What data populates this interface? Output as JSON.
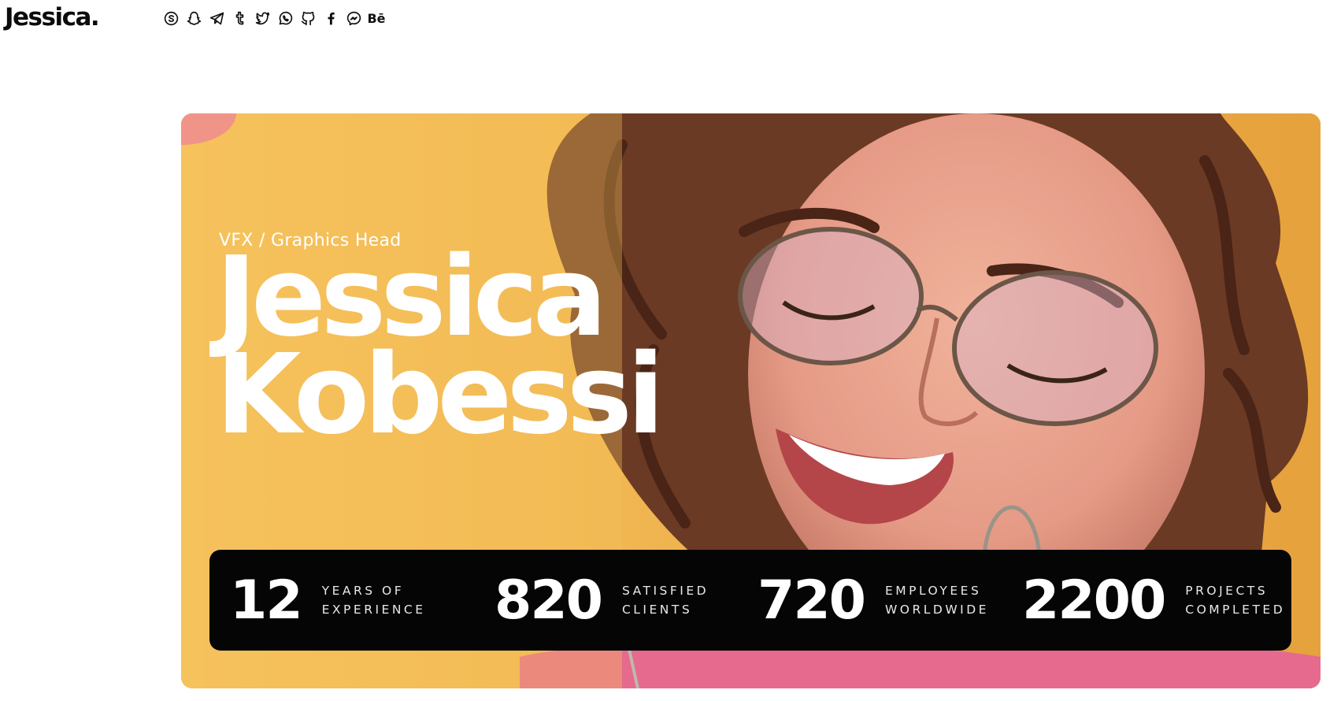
{
  "header": {
    "logo": "Jessica.",
    "social_icons": [
      {
        "name": "skype-icon"
      },
      {
        "name": "snapchat-icon"
      },
      {
        "name": "telegram-icon"
      },
      {
        "name": "tumblr-icon"
      },
      {
        "name": "twitter-icon"
      },
      {
        "name": "whatsapp-icon"
      },
      {
        "name": "github-icon"
      },
      {
        "name": "facebook-icon"
      },
      {
        "name": "messenger-icon"
      },
      {
        "name": "behance-icon",
        "text": "Bē"
      }
    ]
  },
  "hero": {
    "role": "VFX / Graphics Head",
    "first_name": "Jessica",
    "last_name": "Kobessi",
    "stats": [
      {
        "value": "12",
        "label_line1": "YEARS OF",
        "label_line2": "EXPERIENCE"
      },
      {
        "value": "820",
        "label_line1": "SATISFIED",
        "label_line2": "CLIENTS"
      },
      {
        "value": "720",
        "label_line1": "EMPLOYEES",
        "label_line2": "WORLDWIDE"
      },
      {
        "value": "2200",
        "label_line1": "PROJECTS",
        "label_line2": "COMPLETED"
      }
    ]
  },
  "colors": {
    "hero_background": "#f6c15a",
    "stats_background": "#050505",
    "text_light": "#ffffff",
    "text_dark": "#111111"
  }
}
